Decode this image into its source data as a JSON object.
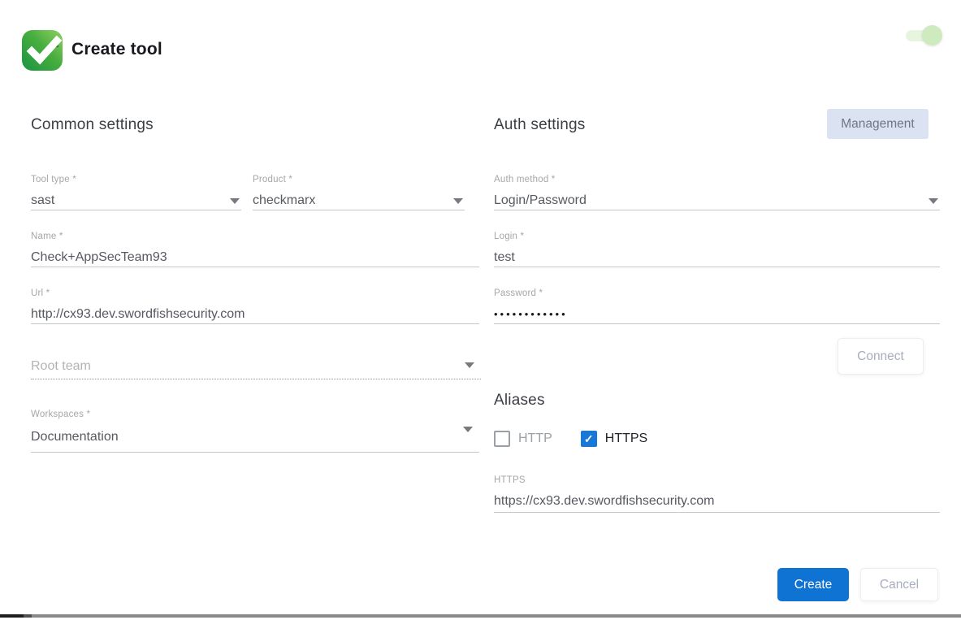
{
  "header": {
    "title": "Create tool",
    "logo": "checkmarx-logo",
    "toggle_state": "on"
  },
  "common": {
    "heading": "Common settings",
    "tool_type": {
      "label": "Tool type *",
      "value": "sast"
    },
    "product": {
      "label": "Product *",
      "value": "checkmarx"
    },
    "name": {
      "label": "Name *",
      "value": "Check+AppSecTeam93"
    },
    "url": {
      "label": "Url *",
      "value": "http://cx93.dev.swordfishsecurity.com"
    },
    "root_team": {
      "placeholder": "Root team"
    },
    "workspaces": {
      "label": "Workspaces *",
      "value": "Documentation"
    }
  },
  "auth": {
    "heading": "Auth settings",
    "management_label": "Management",
    "auth_method": {
      "label": "Auth method *",
      "value": "Login/Password"
    },
    "login": {
      "label": "Login *",
      "value": "test"
    },
    "password": {
      "label": "Password *",
      "value": "••••••••••••"
    },
    "connect_label": "Connect"
  },
  "aliases": {
    "heading": "Aliases",
    "http": {
      "label": "HTTP",
      "checked": false
    },
    "https": {
      "label": "HTTPS",
      "checked": true
    },
    "https_field": {
      "label": "HTTPS",
      "value": "https://cx93.dev.swordfishsecurity.com"
    }
  },
  "footer": {
    "create_label": "Create",
    "cancel_label": "Cancel"
  },
  "colors": {
    "primary_blue": "#0f73d4",
    "checkbox_blue": "#1878d8",
    "chip_bg": "#dbe2f1",
    "toggle_track": "#e7f5df",
    "toggle_thumb": "#cfeabf"
  }
}
